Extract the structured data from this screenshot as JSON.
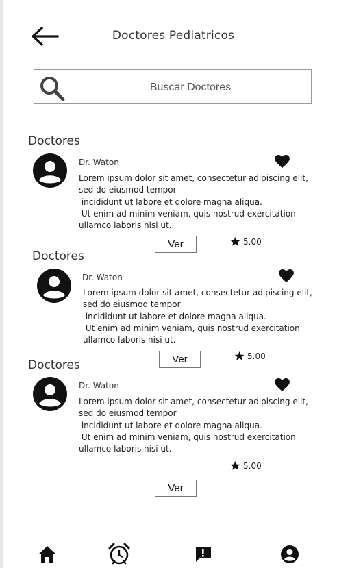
{
  "header": {
    "title": "Doctores Pediatricos",
    "back_icon": "arrow-left-icon"
  },
  "search": {
    "placeholder": "Buscar Doctores",
    "icon": "search-icon"
  },
  "cards": [
    {
      "section_label": "Doctores",
      "name": "Dr. Waton",
      "description": "Lorem ipsum dolor sit amet, consectetur adipiscing elit, sed do eiusmod tempor\n incididunt ut labore et dolore magna aliqua.\n Ut enim ad minim veniam, quis nostrud exercitation ullamco laboris nisi ut.",
      "button_label": "Ver",
      "rating": "5.00"
    },
    {
      "section_label": "Doctores",
      "name": "Dr. Waton",
      "description": "Lorem ipsum dolor sit amet, consectetur adipiscing elit, sed do eiusmod tempor\n incididunt ut labore et dolore magna aliqua.\n Ut enim ad minim veniam, quis nostrud exercitation ullamco laboris nisi ut.",
      "button_label": "Ver",
      "rating": "5.00"
    },
    {
      "section_label": "Doctores",
      "name": "Dr. Waton",
      "description": "Lorem ipsum dolor sit amet, consectetur adipiscing elit, sed do eiusmod tempor\n incididunt ut labore et dolore magna aliqua.\n Ut enim ad minim veniam, quis nostrud exercitation ullamco laboris nisi ut.",
      "button_label": "Ver",
      "rating": "5.00"
    }
  ],
  "bottom_nav": {
    "items": [
      "home-icon",
      "alarm-clock-icon",
      "feedback-icon",
      "account-circle-icon"
    ]
  }
}
